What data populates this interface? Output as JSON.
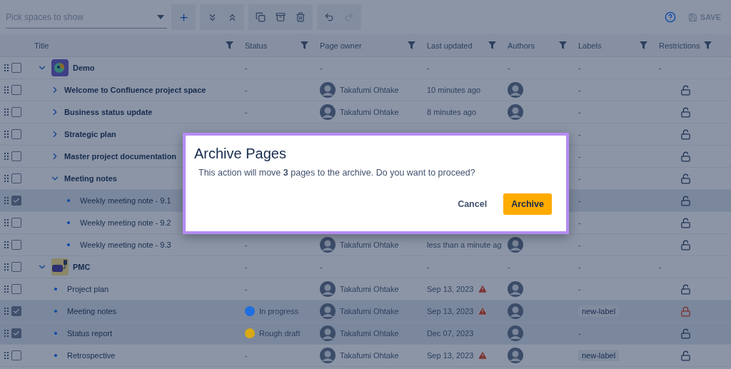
{
  "toolbar": {
    "space_picker": {
      "placeholder": "Pick spaces to show"
    },
    "save": {
      "label": "SAVE",
      "disabled": true
    }
  },
  "columns": [
    {
      "label": "Title"
    },
    {
      "label": "Status"
    },
    {
      "label": "Page owner"
    },
    {
      "label": "Last updated"
    },
    {
      "label": "Authors"
    },
    {
      "label": "Labels"
    },
    {
      "label": "Restrictions"
    }
  ],
  "rows": [
    {
      "kind": "space",
      "title": "Demo",
      "checked": false,
      "expanded": true,
      "status": "-",
      "owner": "-",
      "updated": "-",
      "authors": "-",
      "labels": "-",
      "restrictions": "-",
      "children": [
        {
          "kind": "page",
          "title": "Welcome to Confluence project space",
          "checked": false,
          "expanded": false,
          "status": "-",
          "owner": "Takafumi Ohtake",
          "updated": "10 minutes ago",
          "warning": false,
          "author_avatar": true,
          "labels": "-",
          "restricted": false
        },
        {
          "kind": "page",
          "title": "Business status update",
          "checked": false,
          "expanded": false,
          "status": "-",
          "owner": "Takafumi Ohtake",
          "updated": "8 minutes ago",
          "warning": false,
          "author_avatar": true,
          "labels": "-",
          "restricted": false
        },
        {
          "kind": "page",
          "title": "Strategic plan",
          "checked": false,
          "expanded": false,
          "labels": "-",
          "restricted": false
        },
        {
          "kind": "page",
          "title": "Master project documentation",
          "checked": false,
          "expanded": false,
          "labels": "-",
          "restricted": false
        },
        {
          "kind": "page",
          "title": "Meeting notes",
          "checked": false,
          "expanded": true,
          "labels": "-",
          "restricted": false,
          "children": [
            {
              "kind": "page",
              "title": "Weekly meeting note - 9.1",
              "checked": true,
              "labels": "-",
              "restricted": false
            },
            {
              "kind": "page",
              "title": "Weekly meeting note - 9.2",
              "checked": false,
              "labels": "-",
              "restricted": false
            },
            {
              "kind": "page",
              "title": "Weekly meeting note - 9.3",
              "checked": false,
              "status": "-",
              "owner": "Takafumi Ohtake",
              "updated": "less than a minute ag",
              "warning": false,
              "author_avatar": true,
              "labels": "-",
              "restricted": false
            }
          ]
        }
      ]
    },
    {
      "kind": "space",
      "title": "PMC",
      "checked": false,
      "expanded": true,
      "status": "-",
      "owner": "-",
      "updated": "-",
      "authors": "-",
      "labels": "-",
      "restrictions": "-",
      "children": [
        {
          "kind": "page",
          "title": "Project plan",
          "checked": false,
          "status": "-",
          "owner": "Takafumi Ohtake",
          "updated": "Sep 13, 2023",
          "warning": true,
          "author_avatar": true,
          "labels": "-",
          "restricted": false
        },
        {
          "kind": "page",
          "title": "Meeting notes",
          "checked": true,
          "status": "In progress",
          "color": "#1f6fe0",
          "owner": "Takafumi Ohtake",
          "updated": "Sep 13, 2023",
          "warning": true,
          "author_avatar": true,
          "labels": [
            {
              "text": "new-label"
            }
          ],
          "restricted": true
        },
        {
          "kind": "page",
          "title": "Status report",
          "checked": true,
          "status": "Rough draft",
          "color": "#d9a916",
          "owner": "Takafumi Ohtake",
          "updated": "Dec 07, 2023",
          "warning": false,
          "author_avatar": true,
          "labels": "-",
          "restricted": false
        },
        {
          "kind": "page",
          "title": "Retrospective",
          "checked": false,
          "status": "-",
          "owner": "Takafumi Ohtake",
          "updated": "Sep 13, 2023",
          "warning": true,
          "author_avatar": true,
          "labels": [
            {
              "text": "new-label"
            }
          ],
          "restricted": false
        }
      ]
    }
  ],
  "dialog": {
    "title": "Archive Pages",
    "message": "This action will move **3** pages to the archive. Do you want to proceed?",
    "buttons": [
      {
        "label": "Cancel",
        "kind": "secondary"
      },
      {
        "label": "Archive",
        "kind": "primary"
      }
    ]
  }
}
